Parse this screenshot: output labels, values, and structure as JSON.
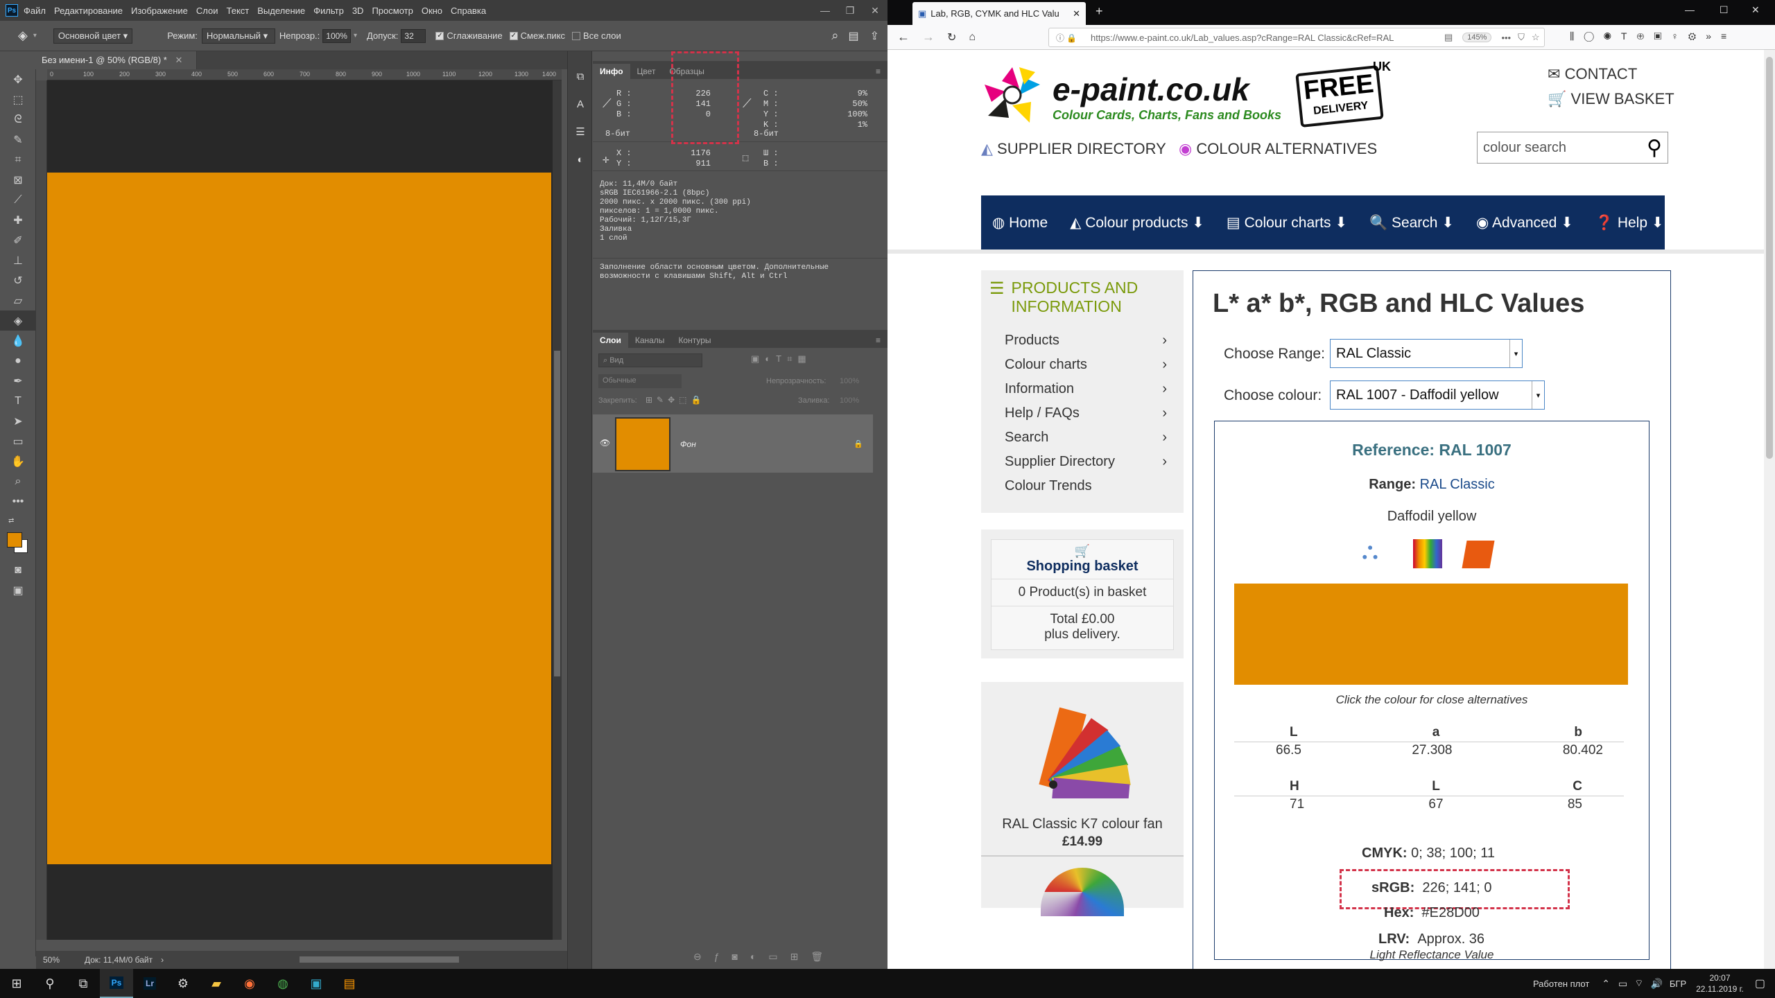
{
  "photoshop": {
    "menu": [
      "Файл",
      "Редактирование",
      "Изображение",
      "Слои",
      "Текст",
      "Выделение",
      "Фильтр",
      "3D",
      "Просмотр",
      "Окно",
      "Справка"
    ],
    "options": {
      "fill_source": "Основной цвет",
      "mode_label": "Режим:",
      "mode_value": "Нормальный",
      "opacity_label": "Непрозр.:",
      "opacity_value": "100%",
      "tolerance_label": "Допуск:",
      "tolerance_value": "32",
      "antialias": "Сглаживание",
      "contiguous": "Смеж.пикс",
      "all_layers": "Все слои"
    },
    "doc_tab": "Без имени-1 @ 50% (RGB/8) *",
    "ruler_ticks": [
      "0",
      "100",
      "200",
      "300",
      "400",
      "500",
      "600",
      "700",
      "800",
      "900",
      "1000",
      "1100",
      "1200",
      "1300",
      "1400"
    ],
    "panel_tabs_top": [
      "Инфо",
      "Цвет",
      "Образцы"
    ],
    "info": {
      "r_label": "R :",
      "g_label": "G :",
      "b_label": "B :",
      "r": "226",
      "g": "141",
      "b": "0",
      "c_label": "C :",
      "m_label": "M :",
      "y_label": "Y :",
      "k_label": "K :",
      "c": "9%",
      "m": "50%",
      "y": "100%",
      "k": "1%",
      "bits_left": "8-бит",
      "bits_right": "8-бит",
      "x_label": "X :",
      "y2_label": "Y :",
      "x": "1176",
      "y2": "911",
      "w_label": "Ш :",
      "h_label": "В :",
      "doc_lines": [
        "Док: 11,4M/0 байт",
        "sRGB IEC61966-2.1 (8bpc)",
        "2000 пикс. x 2000 пикс. (300 ppi)",
        "пикселов: 1 = 1,0000 пикс.",
        "Рабочий: 1,12Г/15,3Г",
        "Заливка",
        "1 слой"
      ],
      "hint": "Заполнение области основным цветом. Дополнительные возможности с клавишами Shift, Alt и Ctrl"
    },
    "layers": {
      "tabs": [
        "Слои",
        "Каналы",
        "Контуры"
      ],
      "filter_placeholder": "Вид",
      "blend": "Обычные",
      "opacity_label": "Непрозрачность:",
      "opacity_value": "100%",
      "lock_label": "Закрепить:",
      "fill_label": "Заливка:",
      "fill_value": "100%",
      "layer_name": "Фон"
    },
    "status": {
      "zoom": "50%",
      "doc": "Док: 11,4M/0 байт"
    },
    "colors": {
      "foreground": "#e28d00",
      "canvas": "#e28d00"
    }
  },
  "browser": {
    "tab_title": "Lab, RGB, CYMK and HLC Valu",
    "url": "https://www.e-paint.co.uk/Lab_values.asp?cRange=RAL Classic&cRef=RAL",
    "zoom": "145%",
    "site": {
      "logo_text": "e-paint.co.uk",
      "tagline": "Colour Cards, Charts, Fans and Books",
      "free_delivery_top": "FREE",
      "free_delivery_bottom": "DELIVERY",
      "free_delivery_uk": "UK",
      "contact": "CONTACT",
      "basket": "VIEW BASKET",
      "supplier_directory": "SUPPLIER DIRECTORY",
      "colour_alternatives": "COLOUR ALTERNATIVES",
      "search_placeholder": "colour search",
      "nav": [
        "Home",
        "Colour products",
        "Colour charts",
        "Search",
        "Advanced",
        "Help"
      ],
      "sidebar_title": "PRODUCTS AND INFORMATION",
      "sidebar_items": [
        "Products",
        "Colour charts",
        "Information",
        "Help / FAQs",
        "Search",
        "Supplier Directory",
        "Colour Trends"
      ],
      "basket_title": "Shopping basket",
      "basket_count": "0 Product(s) in basket",
      "basket_total": "Total £0.00",
      "basket_delivery": "plus delivery.",
      "product_name": "RAL Classic K7 colour fan",
      "product_price": "£14.99",
      "main_title": "L* a* b*, RGB and HLC Values",
      "choose_range_label": "Choose Range:",
      "choose_range_value": "RAL Classic",
      "choose_colour_label": "Choose colour:",
      "choose_colour_value": "RAL 1007 - Daffodil yellow",
      "reference_label": "Reference:",
      "reference_value": "RAL 1007",
      "range_label": "Range:",
      "range_value": "RAL Classic",
      "colour_name": "Daffodil yellow",
      "swatch_color": "#e28d00",
      "swatch_caption": "Click the colour for close alternatives",
      "lab": {
        "l_h": "L",
        "a_h": "a",
        "b_h": "b",
        "l": "66.5",
        "a": "27.308",
        "b": "80.402"
      },
      "hlc": {
        "h_h": "H",
        "l_h": "L",
        "c_h": "C",
        "h": "71",
        "l": "67",
        "c": "85"
      },
      "cmyk_label": "CMYK:",
      "cmyk_value": "0; 38; 100; 11",
      "srgb_label": "sRGB:",
      "srgb_value": "226; 141; 0",
      "hex_label": "Hex:",
      "hex_value": "#E28D00",
      "lrv_label": "LRV:",
      "lrv_value": "Approx. 36",
      "lrv_caption": "Light Reflectance Value"
    }
  },
  "taskbar": {
    "status_text": "Работен плот",
    "lang": "БГР",
    "time": "20:07",
    "date": "22.11.2019 г."
  }
}
